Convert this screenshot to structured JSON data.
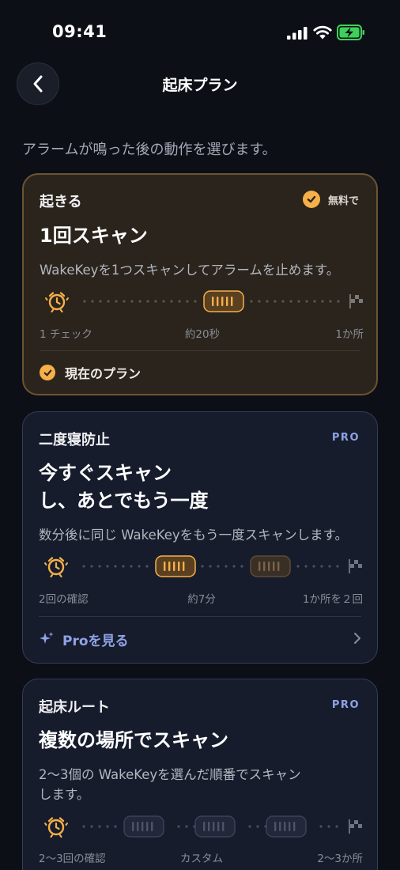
{
  "status_bar": {
    "time": "09:41"
  },
  "header": {
    "title": "起床プラン",
    "back_icon": "chevron-left-icon"
  },
  "intro": "アラームが鳴った後の動作を選びます。",
  "colors": {
    "accent_orange": "#f5b04a",
    "accent_blue": "#8fa3e6",
    "current_card_bg": "#2a241c",
    "pro_card_bg": "#161c2c",
    "battery_green": "#3fd05a"
  },
  "plans": [
    {
      "label": "起きる",
      "badge": "無料で",
      "title": "1回スキャン",
      "description": "WakeKeyを1つスキャンしてアラームを止めます。",
      "timeline": {
        "left": "1 チェック",
        "center": "約20秒",
        "right": "1か所"
      },
      "current_label": "現在のプラン"
    },
    {
      "label": "二度寝防止",
      "badge": "PRO",
      "title_line1": "今すぐスキャン",
      "title_line2": "し、あとでもう一度",
      "description": "数分後に同じ WakeKeyをもう一度スキャンします。",
      "timeline": {
        "left": "2回の確認",
        "center": "約7分",
        "right": "1か所を２回"
      },
      "link_label": "Proを見る"
    },
    {
      "label": "起床ルート",
      "badge": "PRO",
      "title": "複数の場所でスキャン",
      "description_line1": "2～3個の WakeKeyを選んだ順番でスキャン",
      "description_line2": "します。",
      "timeline": {
        "left": "2～3回の確認",
        "center": "カスタム",
        "right": "2～3か所"
      }
    }
  ]
}
